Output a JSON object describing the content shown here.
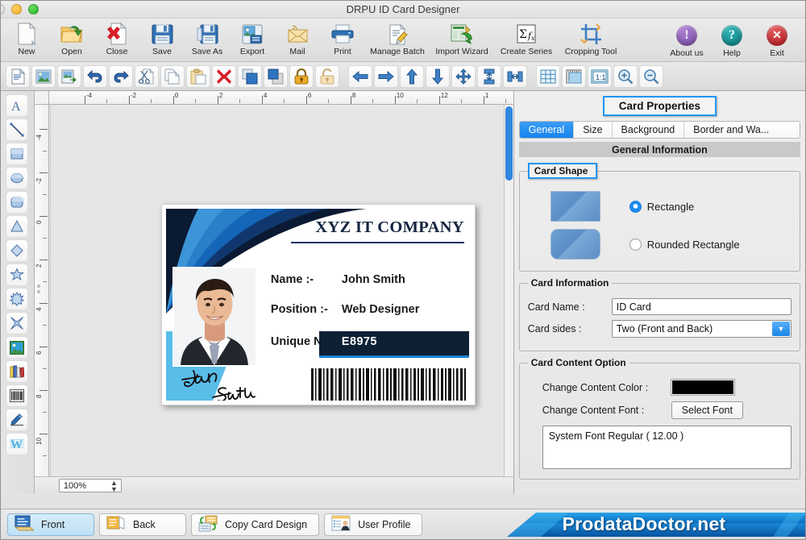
{
  "window": {
    "title": "DRPU ID Card Designer",
    "lights": [
      "grey",
      "yellow",
      "green"
    ]
  },
  "toolbar_main": {
    "items": [
      {
        "label": "New",
        "icon": "new-document-icon"
      },
      {
        "label": "Open",
        "icon": "open-folder-icon"
      },
      {
        "label": "Close",
        "icon": "close-document-icon"
      },
      {
        "label": "Save",
        "icon": "save-disk-icon"
      },
      {
        "label": "Save As",
        "icon": "save-as-icon"
      },
      {
        "label": "Export",
        "icon": "export-icon"
      },
      {
        "label": "Mail",
        "icon": "mail-envelope-icon"
      },
      {
        "label": "Print",
        "icon": "printer-icon"
      },
      {
        "label": "Manage Batch",
        "icon": "manage-batch-icon"
      },
      {
        "label": "Import Wizard",
        "icon": "import-wizard-icon"
      },
      {
        "label": "Create Series",
        "icon": "create-series-icon"
      },
      {
        "label": "Cropping Tool",
        "icon": "cropping-tool-icon"
      }
    ],
    "right_items": [
      {
        "label": "About us",
        "icon": "info-circle-icon",
        "color": "#8e5ab5",
        "glyph": "!"
      },
      {
        "label": "Help",
        "icon": "question-circle-icon",
        "color": "#0f8e92",
        "glyph": "?"
      },
      {
        "label": "Exit",
        "icon": "exit-circle-icon",
        "color": "#cc2227",
        "glyph": "✕"
      }
    ]
  },
  "toolbar_secondary": {
    "items": [
      {
        "name": "edit-text-icon"
      },
      {
        "name": "insert-image-icon"
      },
      {
        "name": "export-image-icon"
      },
      {
        "name": "undo-icon"
      },
      {
        "name": "redo-icon"
      },
      {
        "name": "cut-icon"
      },
      {
        "name": "copy-icon"
      },
      {
        "name": "paste-icon"
      },
      {
        "name": "delete-icon"
      },
      {
        "name": "bring-to-front-icon"
      },
      {
        "name": "send-to-back-icon"
      },
      {
        "name": "lock-icon"
      },
      {
        "name": "unlock-icon"
      },
      {
        "name": "align-left-icon"
      },
      {
        "name": "align-right-icon"
      },
      {
        "name": "align-top-icon"
      },
      {
        "name": "align-bottom-icon"
      },
      {
        "name": "center-both-icon"
      },
      {
        "name": "center-horizontal-icon"
      },
      {
        "name": "center-vertical-icon"
      },
      {
        "name": "grid-icon"
      },
      {
        "name": "ruler-icon"
      },
      {
        "name": "actual-size-icon",
        "text": "1:1"
      },
      {
        "name": "zoom-in-icon"
      },
      {
        "name": "zoom-out-icon"
      }
    ]
  },
  "left_tools": {
    "items": [
      {
        "name": "text-tool",
        "label": "A"
      },
      {
        "name": "line-tool"
      },
      {
        "name": "rectangle-tool"
      },
      {
        "name": "ellipse-tool"
      },
      {
        "name": "rounded-rectangle-tool"
      },
      {
        "name": "triangle-tool"
      },
      {
        "name": "diamond-tool"
      },
      {
        "name": "star-tool"
      },
      {
        "name": "burst-tool"
      },
      {
        "name": "four-point-star-tool"
      },
      {
        "name": "image-tool"
      },
      {
        "name": "books-tool"
      },
      {
        "name": "barcode-tool"
      },
      {
        "name": "signature-tool"
      },
      {
        "name": "watermark-tool",
        "label": "W"
      }
    ]
  },
  "canvas": {
    "ruler_h_labels": [
      "-4",
      "-2",
      "0",
      "2",
      "4",
      "6",
      "8",
      "10",
      "12",
      "1"
    ],
    "ruler_v_labels": [
      "-4",
      "-2",
      "0",
      "2",
      "4",
      "6",
      "8",
      "10"
    ],
    "zoom_value": "100%"
  },
  "card": {
    "company": "XYZ IT COMPANY",
    "fields": [
      {
        "label": "Name :-",
        "value": "John Smith"
      },
      {
        "label": "Position :-",
        "value": "Web Designer"
      },
      {
        "label": "Unique No :-",
        "value": "E8975"
      }
    ],
    "signature_line1": "John",
    "signature_line2": "Smith",
    "colors": {
      "navy": "#0b1a33",
      "blue_mid": "#1565b8",
      "blue_light": "#3d95d8",
      "cyan": "#59bde9",
      "unique_bg": "#0d2034",
      "unique_underline": "#1a7fd4"
    }
  },
  "properties": {
    "panel_title": "Card Properties",
    "tabs": [
      {
        "label": "General",
        "active": true
      },
      {
        "label": "Size",
        "active": false
      },
      {
        "label": "Background",
        "active": false
      },
      {
        "label": "Border and Wa...",
        "active": false
      }
    ],
    "section_header": "General Information",
    "card_shape": {
      "legend": "Card Shape",
      "options": [
        {
          "label": "Rectangle",
          "selected": true
        },
        {
          "label": "Rounded Rectangle",
          "selected": false
        }
      ]
    },
    "card_information": {
      "legend": "Card Information",
      "card_name_label": "Card Name :",
      "card_name_value": "ID Card",
      "card_sides_label": "Card sides :",
      "card_sides_value": "Two (Front and Back)"
    },
    "card_content_option": {
      "legend": "Card Content Option",
      "content_color_label": "Change Content Color :",
      "content_color_value": "#000000",
      "content_font_label": "Change Content Font :",
      "select_font_button": "Select Font",
      "font_description": "System Font Regular ( 12.00 )"
    }
  },
  "bottom_bar": {
    "buttons": [
      {
        "label": "Front",
        "icon": "front-side-icon",
        "active": true
      },
      {
        "label": "Back",
        "icon": "back-side-icon",
        "active": false
      },
      {
        "label": "Copy Card Design",
        "icon": "copy-card-design-icon",
        "active": false
      },
      {
        "label": "User Profile",
        "icon": "user-profile-icon",
        "active": false
      }
    ],
    "brand": "ProdataDoctor.net"
  }
}
